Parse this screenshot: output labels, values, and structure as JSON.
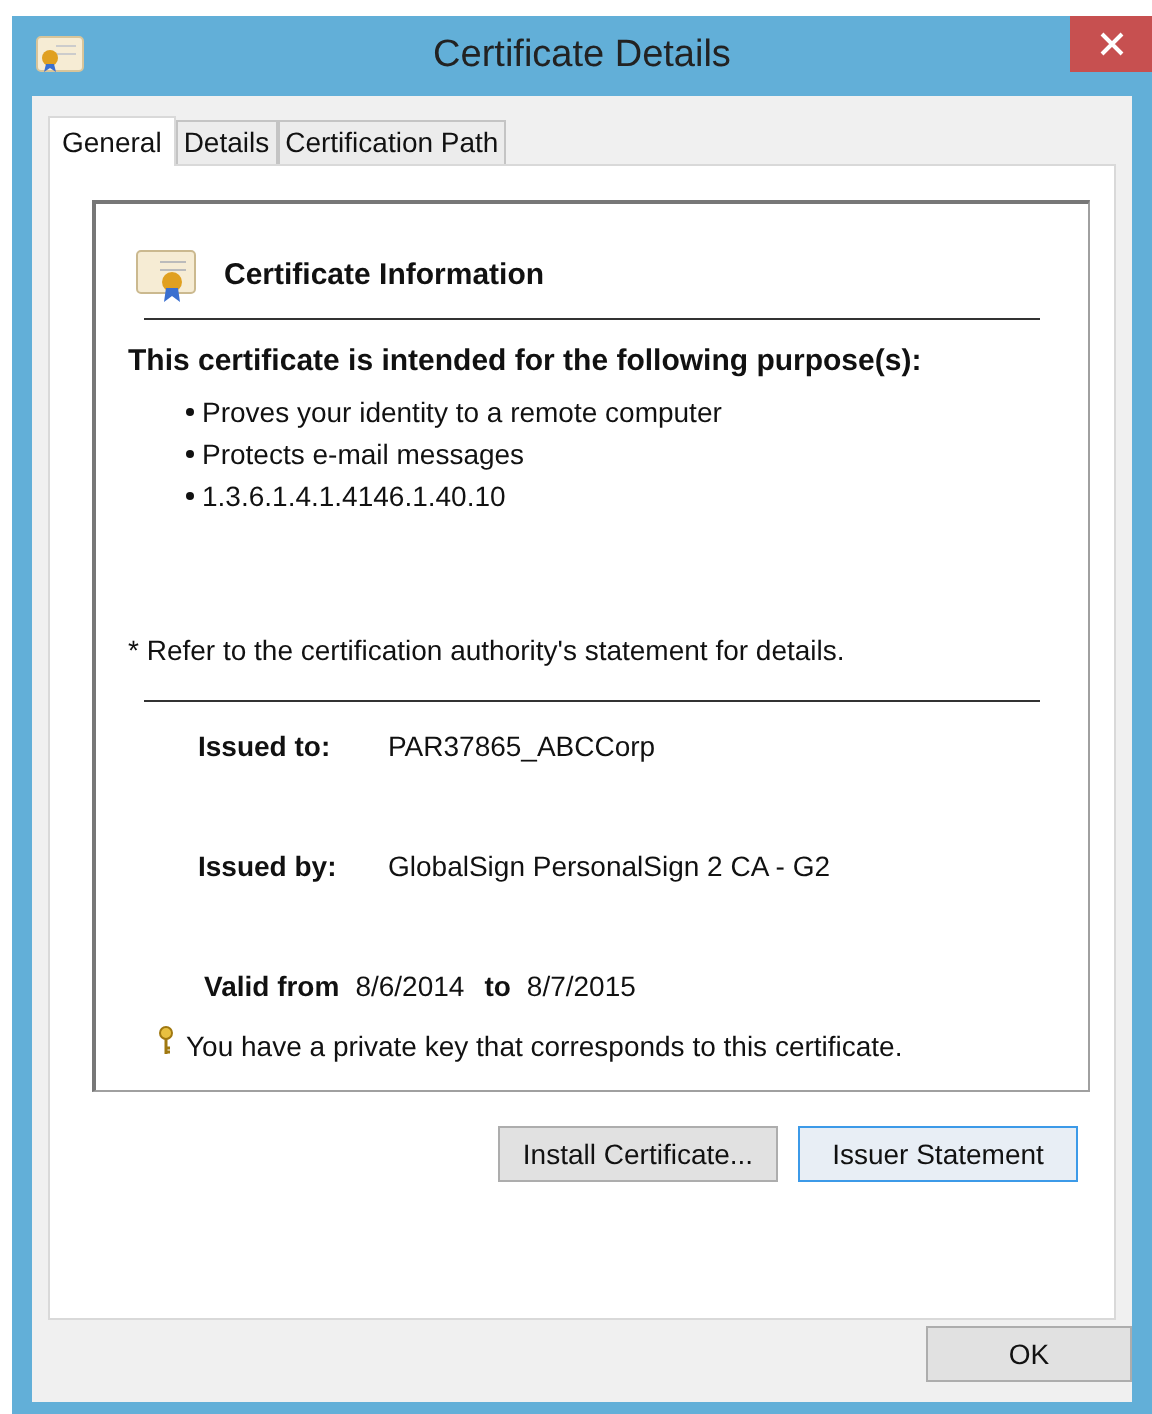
{
  "window": {
    "title": "Certificate Details"
  },
  "tabs": [
    {
      "label": "General",
      "selected": true
    },
    {
      "label": "Details",
      "selected": false
    },
    {
      "label": "Certification Path",
      "selected": false
    }
  ],
  "certificate_information": {
    "heading": "Certificate Information",
    "purpose_heading": "This certificate is intended for the following purpose(s):",
    "purposes": [
      "Proves your identity to a remote computer",
      "Protects e-mail messages",
      "1.3.6.1.4.1.4146.1.40.10"
    ],
    "note": "* Refer to the certification authority's statement for details.",
    "issued_to": {
      "label": "Issued to:",
      "value": "PAR37865_ABCCorp"
    },
    "issued_by": {
      "label": "Issued by:",
      "value": "GlobalSign PersonalSign 2 CA - G2"
    },
    "validity": {
      "from_label": "Valid from",
      "from": "8/6/2014",
      "to_label": "to",
      "to": "8/7/2015"
    },
    "private_key_note": "You have a private key that corresponds to this certificate."
  },
  "panel_buttons": [
    {
      "label": "Install Certificate...",
      "focused": false
    },
    {
      "label": "Issuer Statement",
      "focused": true
    }
  ],
  "footer_buttons": [
    {
      "label": "OK",
      "focused": false
    }
  ]
}
